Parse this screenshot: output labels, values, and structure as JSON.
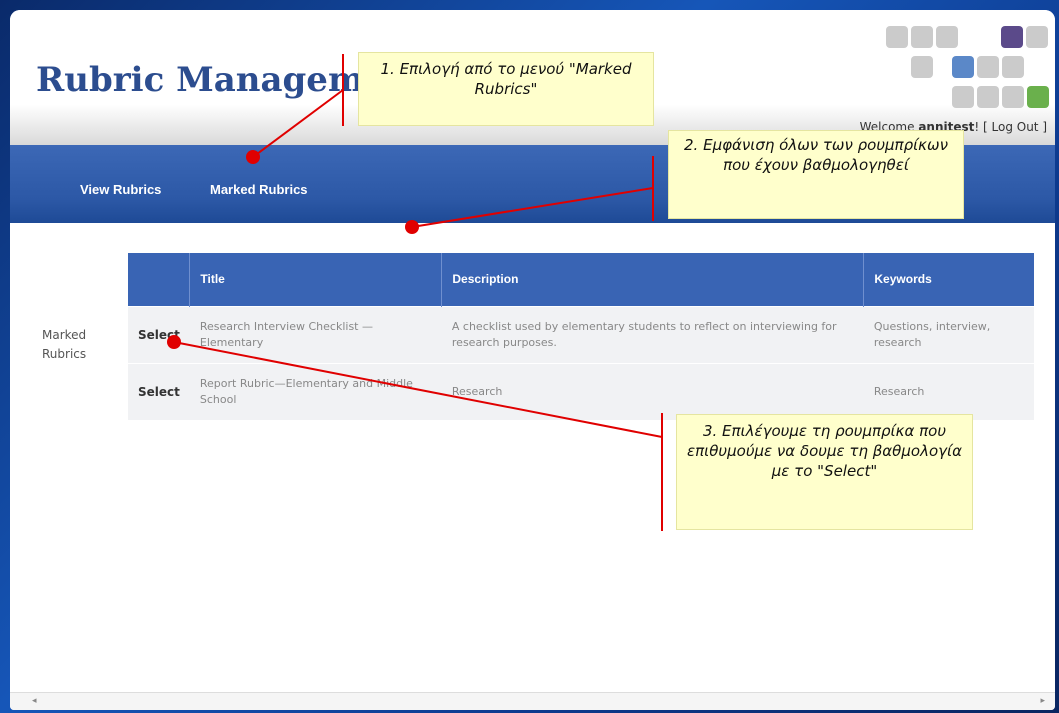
{
  "app": {
    "title": "Rubric Management"
  },
  "header": {
    "welcome_prefix": "Welcome ",
    "welcome_user": "annitest",
    "welcome_logout": "! [ Log Out ]"
  },
  "nav": {
    "items": [
      "View Rubrics",
      "Marked Rubrics"
    ]
  },
  "sidebar": {
    "label_line1": "Marked",
    "label_line2": "Rubrics"
  },
  "table": {
    "headers": [
      "",
      "Title",
      "Description",
      "Keywords"
    ],
    "rows": [
      {
        "action": "Select",
        "title": "Research Interview Checklist —Elementary",
        "description": "A checklist used by elementary students to reflect on interviewing for research purposes.",
        "keywords": "Questions, interview, research"
      },
      {
        "action": "Select",
        "title": "Report Rubric—Elementary and Middle School",
        "description": "Research",
        "keywords": "Research"
      }
    ]
  },
  "annotations": [
    {
      "text": "1. Επιλογή από το μενού \"Marked Rubrics\""
    },
    {
      "text": "2. Εμφάνιση όλων των ρουμπρίκων που έχουν βαθμολογηθεί"
    },
    {
      "text": "3. Επιλέγουμε τη ρουμπρίκα που επιθυμούμε να δουμε τη βαθμολογία με το \"Select\""
    }
  ],
  "colors": {
    "brand_blue": "#2c4d8f",
    "nav_blue": "#2c58a6",
    "header_blue": "#3964b4",
    "annotation_bg": "#ffffcc",
    "annotation_line": "#e00000",
    "tile_gray": "#cbcbcb",
    "tile_purple": "#5b4a8a",
    "tile_blue": "#5b88c8",
    "tile_green": "#6ab04c"
  }
}
